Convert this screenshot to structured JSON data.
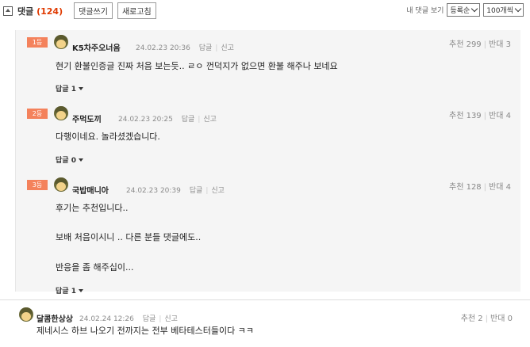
{
  "toolbar": {
    "title": "댓글",
    "count": "(124)",
    "write_label": "댓글쓰기",
    "refresh_label": "새로고침",
    "my_comments_label": "내 댓글 보기",
    "sort_value": "등록순",
    "per_page_value": "100개씩"
  },
  "replies": [
    {
      "rank": "1등",
      "nick": "K5차주오너음",
      "date": "24.02.23 20:36",
      "reply_label": "답글",
      "report_label": "신고",
      "votes": "추천 299",
      "downvotes": "반대 3",
      "lines": [
        "현기 환불인증글 진짜 처음 보는듯.. ㄹㅇ 껀덕지가 없으면 환불 해주나 보네요"
      ],
      "reply_count": "답글 1"
    },
    {
      "rank": "2등",
      "nick": "주먹도끼",
      "date": "24.02.23 20:25",
      "reply_label": "답글",
      "report_label": "신고",
      "votes": "추천 139",
      "downvotes": "반대 4",
      "lines": [
        "다행이네요. 놀라셨겠습니다."
      ],
      "reply_count": "답글 0"
    },
    {
      "rank": "3등",
      "nick": "국밥매니아",
      "date": "24.02.23 20:39",
      "reply_label": "답글",
      "report_label": "신고",
      "votes": "추천 128",
      "downvotes": "반대 4",
      "lines": [
        "후기는 추천입니다..",
        "보배 처음이시니 .. 다른 분들 댓글에도..",
        "반응을 좀 해주십이..."
      ],
      "reply_count": "답글 1"
    }
  ],
  "comment": {
    "nick": "달콤한상상",
    "date": "24.02.24 12:26",
    "reply_label": "답글",
    "report_label": "신고",
    "votes": "추천 2",
    "downvotes": "반대 0",
    "text": "제네시스 하브 나오기 전까지는 전부 베타테스터들이다 ㅋㅋ"
  }
}
